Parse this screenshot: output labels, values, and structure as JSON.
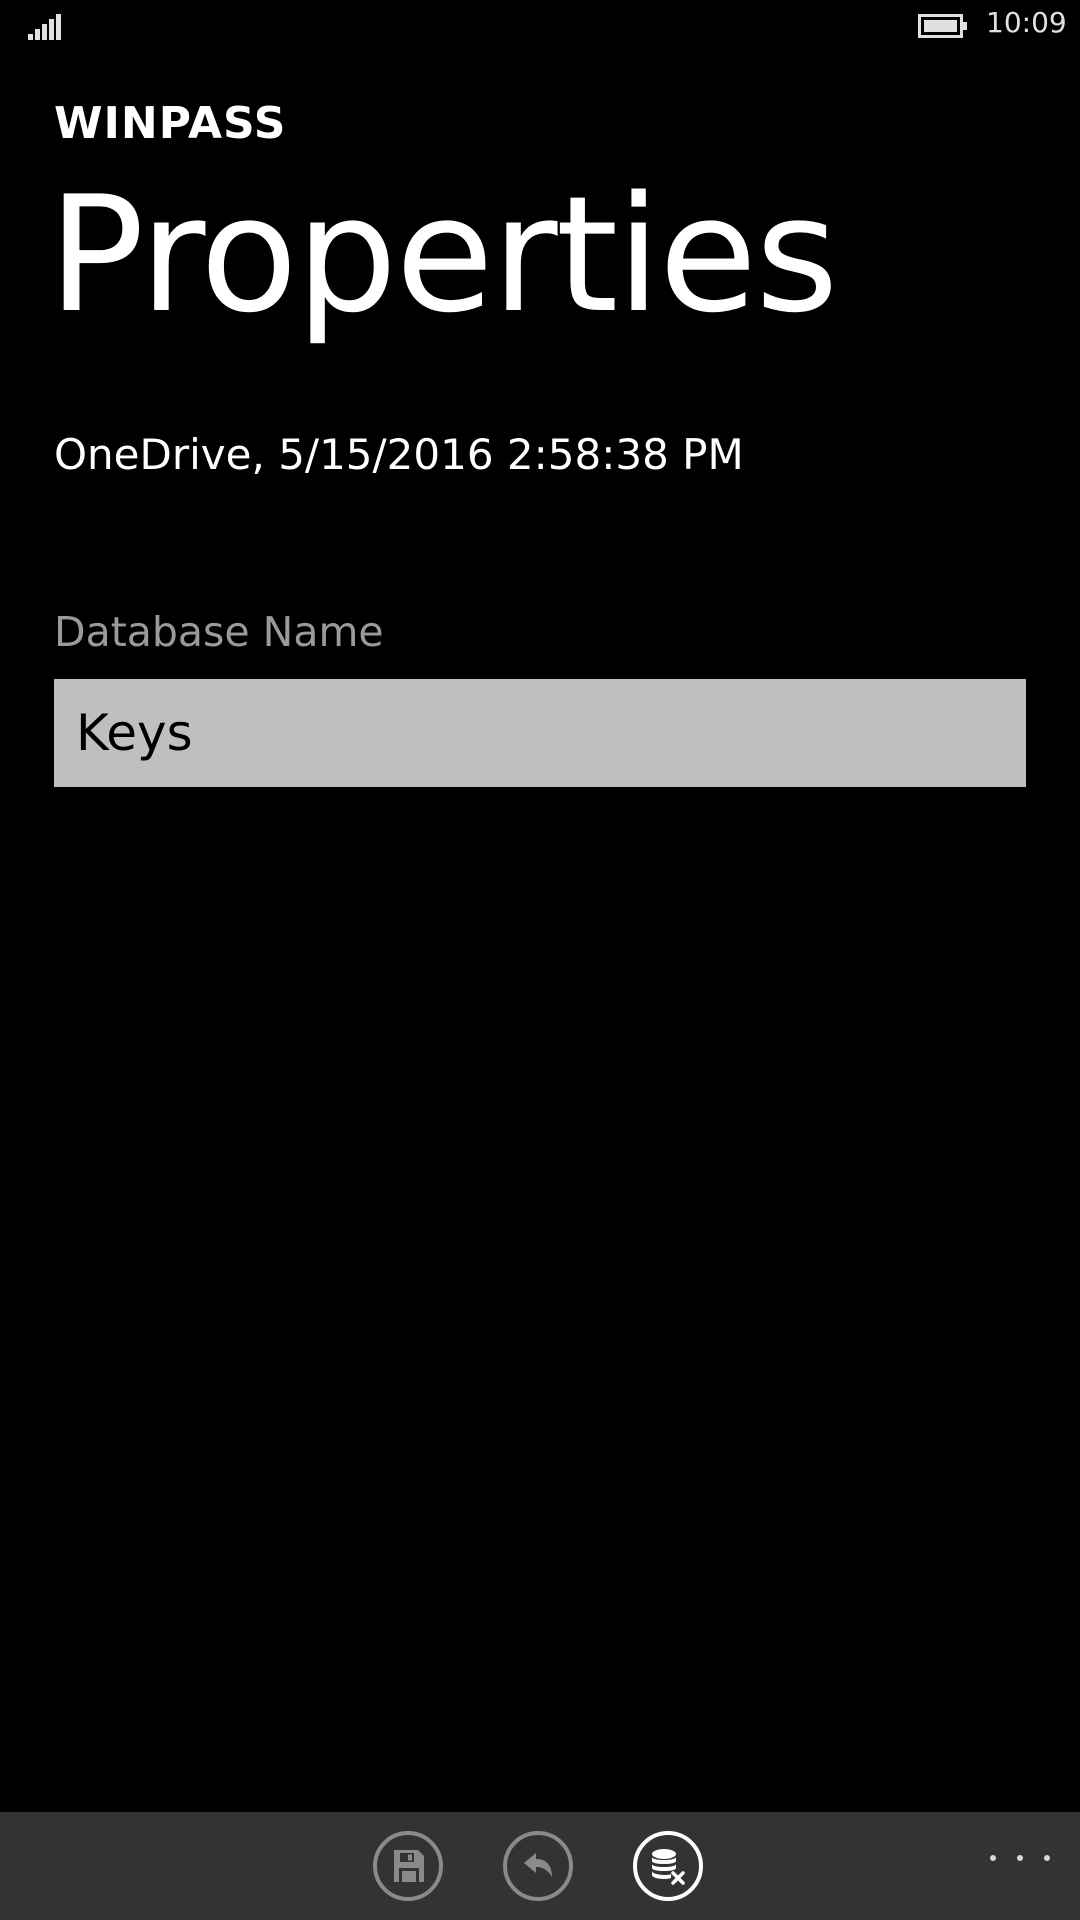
{
  "status_bar": {
    "time": "10:09",
    "signal_icon": "signal-bars-icon",
    "battery_icon": "battery-icon"
  },
  "header": {
    "app_title": "WINPASS",
    "page_title": "Properties"
  },
  "main": {
    "source_info": "OneDrive, 5/15/2016 2:58:38 PM",
    "database_name_label": "Database Name",
    "database_name_value": "Keys"
  },
  "app_bar": {
    "buttons": [
      {
        "icon": "save-icon",
        "label": "save"
      },
      {
        "icon": "undo-icon",
        "label": "undo"
      },
      {
        "icon": "close-database-icon",
        "label": "close database"
      }
    ],
    "more_icon": "more-ellipsis-icon"
  },
  "colors": {
    "background": "#000000",
    "app_bar": "#333333",
    "input_background": "#bfbfbf",
    "label_gray": "#9a9a9a"
  }
}
